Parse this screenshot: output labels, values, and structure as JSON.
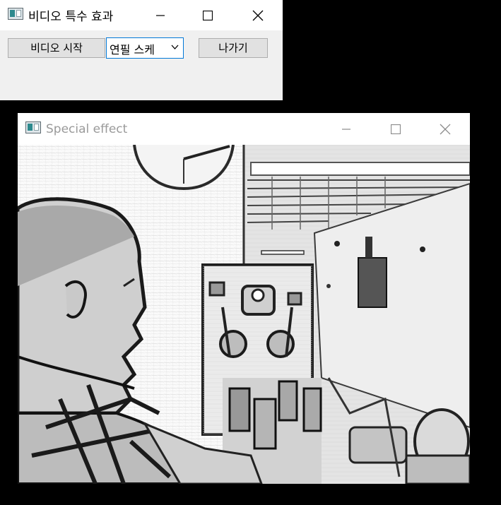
{
  "control_window": {
    "title": "비디오 특수 효과",
    "icon": "app-window-icon",
    "buttons": {
      "start_label": "비디오 시작",
      "exit_label": "나가기"
    },
    "effect_select": {
      "selected": "연필 스케",
      "icon": "chevron-down-icon"
    }
  },
  "effect_window": {
    "title": "Special effect",
    "icon": "app-window-icon",
    "frame_description_icon": "video-frame"
  },
  "colors": {
    "desktop": "#000000",
    "dialog_bg": "#f0f0f0",
    "combo_focus": "#0078d7",
    "inactive_title": "#9a9a9a"
  }
}
